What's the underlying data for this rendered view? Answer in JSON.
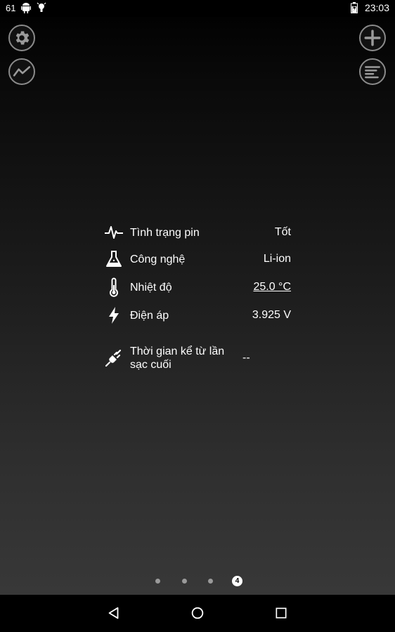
{
  "status_bar": {
    "notification_count": "61",
    "time": "23:03"
  },
  "toolbar": {
    "settings_icon": "gear-icon",
    "chart_icon": "chart-icon",
    "add_icon": "plus-icon",
    "list_icon": "list-icon"
  },
  "battery_info": [
    {
      "icon": "pulse-icon",
      "label": "Tình trạng pin",
      "value": "Tốt"
    },
    {
      "icon": "flask-icon",
      "label": "Công nghệ",
      "value": "Li-ion"
    },
    {
      "icon": "thermometer-icon",
      "label": "Nhiệt độ",
      "value": "25.0 °C"
    },
    {
      "icon": "lightning-icon",
      "label": "Điện áp",
      "value": "3.925 V"
    },
    {
      "icon": "plug-icon",
      "label": "Thời gian kể từ lần sạc cuối",
      "value": "--"
    }
  ],
  "pager": {
    "total_pages": 4,
    "current_page": "4"
  },
  "colors": {
    "background_top": "#000000",
    "background_bottom": "#383838",
    "button_border": "#8a8a8a",
    "text": "#ffffff"
  }
}
